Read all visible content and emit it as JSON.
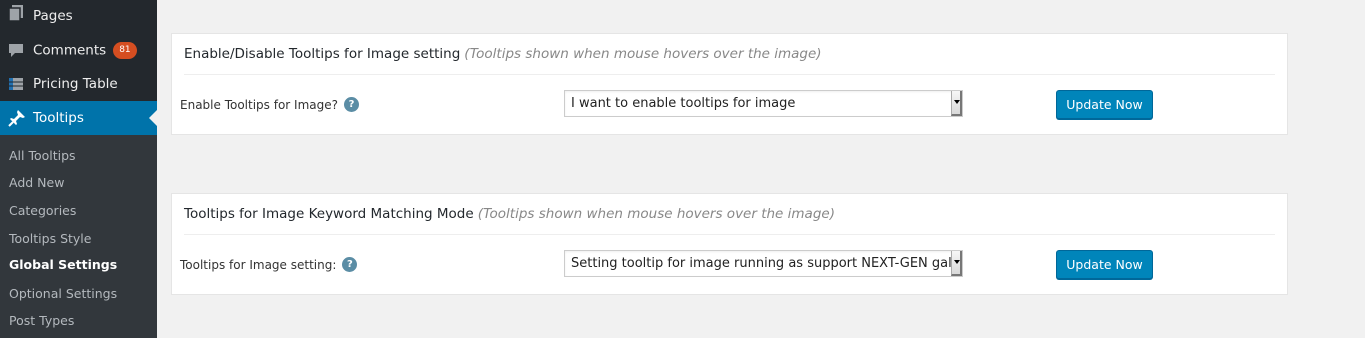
{
  "sidebar": {
    "menu": [
      {
        "label": "Pages",
        "icon": "pages-icon"
      },
      {
        "label": "Comments",
        "icon": "comments-icon",
        "badge": "81"
      },
      {
        "label": "Pricing Table",
        "icon": "table-icon"
      },
      {
        "label": "Tooltips",
        "icon": "pushpin-icon",
        "current": true
      }
    ],
    "submenu": [
      {
        "label": "All Tooltips"
      },
      {
        "label": "Add New"
      },
      {
        "label": "Categories"
      },
      {
        "label": "Tooltips Style"
      },
      {
        "label": "Global Settings",
        "active": true
      },
      {
        "label": "Optional Settings"
      },
      {
        "label": "Post Types"
      }
    ]
  },
  "panels": [
    {
      "title": "Enable/Disable Tooltips for Image setting",
      "note": "(Tooltips shown when mouse hovers over the image)",
      "label": "Enable Tooltips for Image?",
      "help": "?",
      "select_value": "I want to enable tooltips for image",
      "button": "Update Now"
    },
    {
      "title": "Tooltips for Image Keyword Matching Mode",
      "note": "(Tooltips shown when mouse hovers over the image)",
      "label": "Tooltips for Image setting:",
      "help": "?",
      "select_value": "Setting tooltip for image running as support NEXT-GEN gallery",
      "button": "Update Now"
    }
  ],
  "colors": {
    "sidebar_bg": "#23282d",
    "submenu_bg": "#32373c",
    "accent": "#0073aa",
    "button": "#0085ba",
    "badge": "#d54e21"
  }
}
